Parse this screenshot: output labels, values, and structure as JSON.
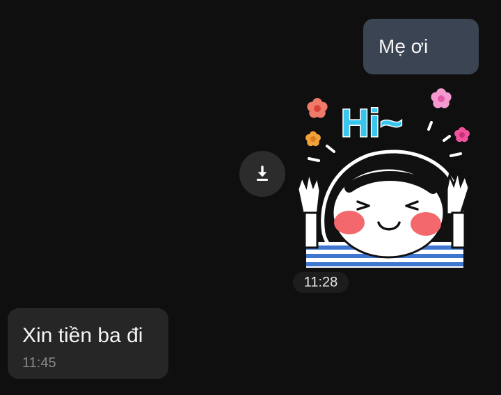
{
  "messages": [
    {
      "direction": "outgoing",
      "type": "text",
      "text": "Mẹ ơi"
    },
    {
      "direction": "outgoing",
      "type": "sticker",
      "sticker_text": "Hi~",
      "time": "11:28"
    },
    {
      "direction": "incoming",
      "type": "text",
      "text": "Xin tiền ba đi",
      "time": "11:45"
    }
  ],
  "icons": {
    "download": "download-icon"
  },
  "colors": {
    "background": "#0f0f0f",
    "outgoing_bubble": "#3b4452",
    "incoming_bubble": "#262626",
    "timestamp": "#8a8a8a"
  }
}
